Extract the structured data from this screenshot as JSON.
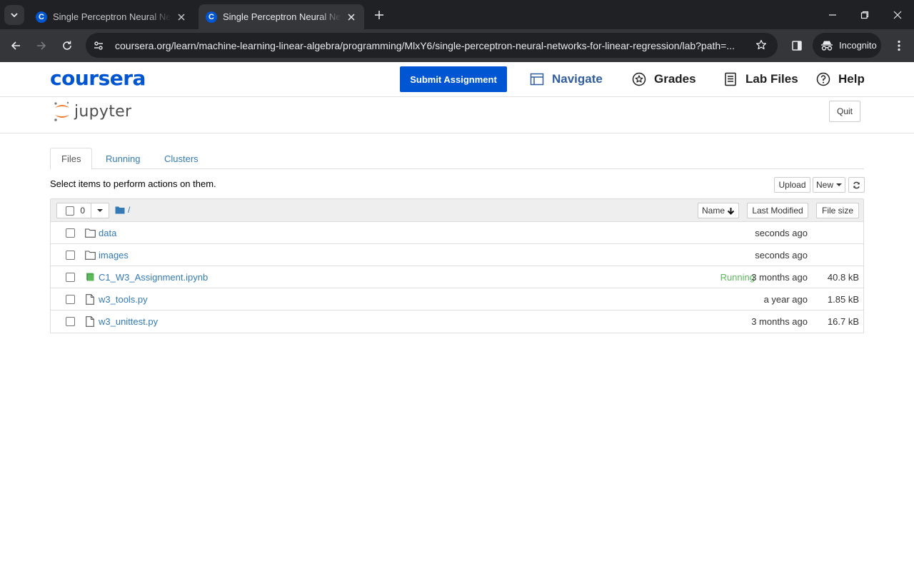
{
  "browser": {
    "tabs": [
      {
        "title": "Single Perceptron Neural Netw",
        "favicon": "C"
      },
      {
        "title": "Single Perceptron Neural Netw",
        "favicon": "C"
      }
    ],
    "url": "coursera.org/learn/machine-learning-linear-algebra/programming/MlxY6/single-perceptron-neural-networks-for-linear-regression/lab?path=...",
    "incognito_label": "Incognito"
  },
  "coursera": {
    "logo": "coursera",
    "submit_label": "Submit Assignment",
    "nav": {
      "navigate": "Navigate",
      "grades": "Grades",
      "lab_files": "Lab Files",
      "help": "Help"
    },
    "accent": "#0056d2"
  },
  "jupyter": {
    "logo_text": "jupyter",
    "quit_label": "Quit",
    "tabs": [
      "Files",
      "Running",
      "Clusters"
    ],
    "select_hint": "Select items to perform actions on them.",
    "upload_label": "Upload",
    "new_label": "New",
    "selected_count": "0",
    "breadcrumb": "/",
    "columns": {
      "name": "Name",
      "last_modified": "Last Modified",
      "file_size": "File size"
    },
    "files": [
      {
        "name": "data",
        "type": "folder",
        "status": "",
        "modified": "seconds ago",
        "size": ""
      },
      {
        "name": "images",
        "type": "folder",
        "status": "",
        "modified": "seconds ago",
        "size": ""
      },
      {
        "name": "C1_W3_Assignment.ipynb",
        "type": "notebook",
        "status": "Running",
        "modified": "3 months ago",
        "size": "40.8 kB"
      },
      {
        "name": "w3_tools.py",
        "type": "file",
        "status": "",
        "modified": "a year ago",
        "size": "1.85 kB"
      },
      {
        "name": "w3_unittest.py",
        "type": "file",
        "status": "",
        "modified": "3 months ago",
        "size": "16.7 kB"
      }
    ]
  }
}
